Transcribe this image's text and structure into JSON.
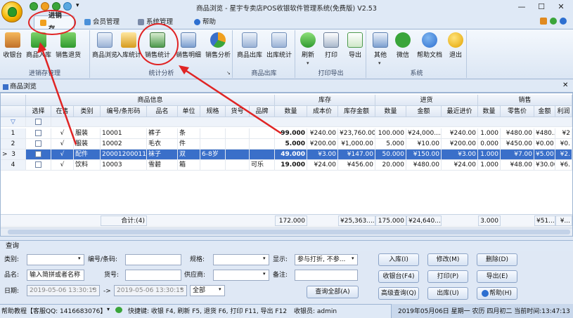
{
  "window": {
    "title": "商品浏览 - 星宇专卖店POS收银软件管理系统(免费版) V2.53"
  },
  "tabs": [
    {
      "label": "进销存"
    },
    {
      "label": "会员管理"
    },
    {
      "label": "系统管理"
    },
    {
      "label": "帮助"
    }
  ],
  "ribbon": {
    "groups": [
      {
        "label": "进销存管理",
        "buttons": [
          {
            "label": "收银台"
          },
          {
            "label": "商品入库"
          },
          {
            "label": "销售退货"
          }
        ]
      },
      {
        "label": "统计分析",
        "buttons": [
          {
            "label": "商品浏览"
          },
          {
            "label": "入库统计"
          },
          {
            "label": "销售统计"
          },
          {
            "label": "销售明细"
          },
          {
            "label": "销售分析"
          }
        ]
      },
      {
        "label": "商品出库",
        "buttons": [
          {
            "label": "商品出库"
          },
          {
            "label": "出库统计"
          }
        ]
      },
      {
        "label": "打印导出",
        "buttons": [
          {
            "label": "刷新"
          },
          {
            "label": "打印"
          },
          {
            "label": "导出"
          }
        ]
      },
      {
        "label": "系统",
        "buttons": [
          {
            "label": "其他"
          },
          {
            "label": "微信"
          },
          {
            "label": "帮助文档"
          },
          {
            "label": "退出"
          }
        ]
      }
    ]
  },
  "panel": {
    "title": "商品浏览"
  },
  "grid": {
    "group_headers": [
      "商品信息",
      "库存",
      "进货",
      "销售"
    ],
    "columns": [
      "选择",
      "在售",
      "类别",
      "编号/条形码",
      "品名",
      "单位",
      "规格",
      "货号",
      "品牌",
      "数量",
      "成本价",
      "库存金额",
      "数量",
      "金额",
      "最近进价",
      "数量",
      "零售价",
      "金额",
      "利润"
    ],
    "rows": [
      {
        "n": "1",
        "onsale": "√",
        "cat": "服装",
        "code": "10001",
        "name": "裤子",
        "unit": "条",
        "spec": "",
        "sku": "",
        "brand": "",
        "qty": "99.000",
        "cost": "¥240.00",
        "stock_amt": "¥23,760.00",
        "in_qty": "100.000",
        "in_amt": "¥24,000....",
        "last_price": "¥240.00",
        "s_qty": "1.000",
        "retail": "¥480.00",
        "s_amt": "¥480....",
        "profit": "¥2"
      },
      {
        "n": "2",
        "onsale": "√",
        "cat": "服装",
        "code": "10002",
        "name": "毛衣",
        "unit": "件",
        "spec": "",
        "sku": "",
        "brand": "",
        "qty": "5.000",
        "cost": "¥200.00",
        "stock_amt": "¥1,000.00",
        "in_qty": "5.000",
        "in_amt": "¥10.00",
        "last_price": "¥200.00",
        "s_qty": "0.000",
        "retail": "¥450.00",
        "s_amt": "¥0.00",
        "profit": "¥0."
      },
      {
        "n": "3",
        "onsale": "√",
        "cat": "配件",
        "code": "20001200011",
        "name": "袜子",
        "unit": "双",
        "spec": "6-8岁",
        "sku": "",
        "brand": "",
        "qty": "49.000",
        "cost": "¥3.00",
        "stock_amt": "¥147.00",
        "in_qty": "50.000",
        "in_amt": "¥150.00",
        "last_price": "¥3.00",
        "s_qty": "1.000",
        "retail": "¥7.00",
        "s_amt": "¥5.00",
        "profit": "¥2."
      },
      {
        "n": "4",
        "onsale": "√",
        "cat": "饮料",
        "code": "10003",
        "name": "雪碧",
        "unit": "箱",
        "spec": "",
        "sku": "",
        "brand": "可乐",
        "qty": "19.000",
        "cost": "¥24.00",
        "stock_amt": "¥456.00",
        "in_qty": "20.000",
        "in_amt": "¥480.00",
        "last_price": "¥24.00",
        "s_qty": "1.000",
        "retail": "¥48.00",
        "s_amt": "¥30.00",
        "profit": "¥6."
      }
    ],
    "current_row_marker": ">",
    "totals": {
      "label": "合计:(4)",
      "qty": "172.000",
      "stock_amt": "¥25,363....",
      "in_qty": "175.000",
      "in_amt": "¥24,640....",
      "s_qty": "3.000",
      "s_amt": "¥51....",
      "profit": "¥..."
    }
  },
  "query": {
    "title": "查询",
    "labels": {
      "category": "类别:",
      "code": "编号/条码:",
      "spec": "规格:",
      "display": "显示:",
      "name": "品名:",
      "sku": "货号:",
      "supplier": "供应商:",
      "remark": "备注:",
      "date": "日期:"
    },
    "name_placeholder": "输入简拼或者名称",
    "display_value": "参与打折, 不参...",
    "date_from": "2019-05-06 13:30:13",
    "date_to": "2019-05-06 13:30:13",
    "date_sep": "->",
    "range_value": "全部",
    "buttons": {
      "query_all": "查询全部(A)",
      "stock_in": "入库(I)",
      "modify": "修改(M)",
      "delete": "删除(D)",
      "cashier": "收银台(F4)",
      "print": "打印(P)",
      "export": "导出(E)",
      "adv_query": "高级查询(Q)",
      "stock_out": "出库(U)",
      "help": "帮助(H)"
    }
  },
  "status": {
    "help": "帮助教程【客服QQ: 1416683076】",
    "shortcuts": "快捷键: 收银 F4, 刷新 F5, 退货 F6, 打印 F11, 导出 F12",
    "cashier": "收银员: admin",
    "datetime": "2019年05月06日 星期一 农历 四月初二 当前时间:13:47:13"
  },
  "colors": {
    "accent": "#3a6fc9",
    "annotation": "#e02424",
    "ribbon_bg": "#dbe6f4"
  }
}
